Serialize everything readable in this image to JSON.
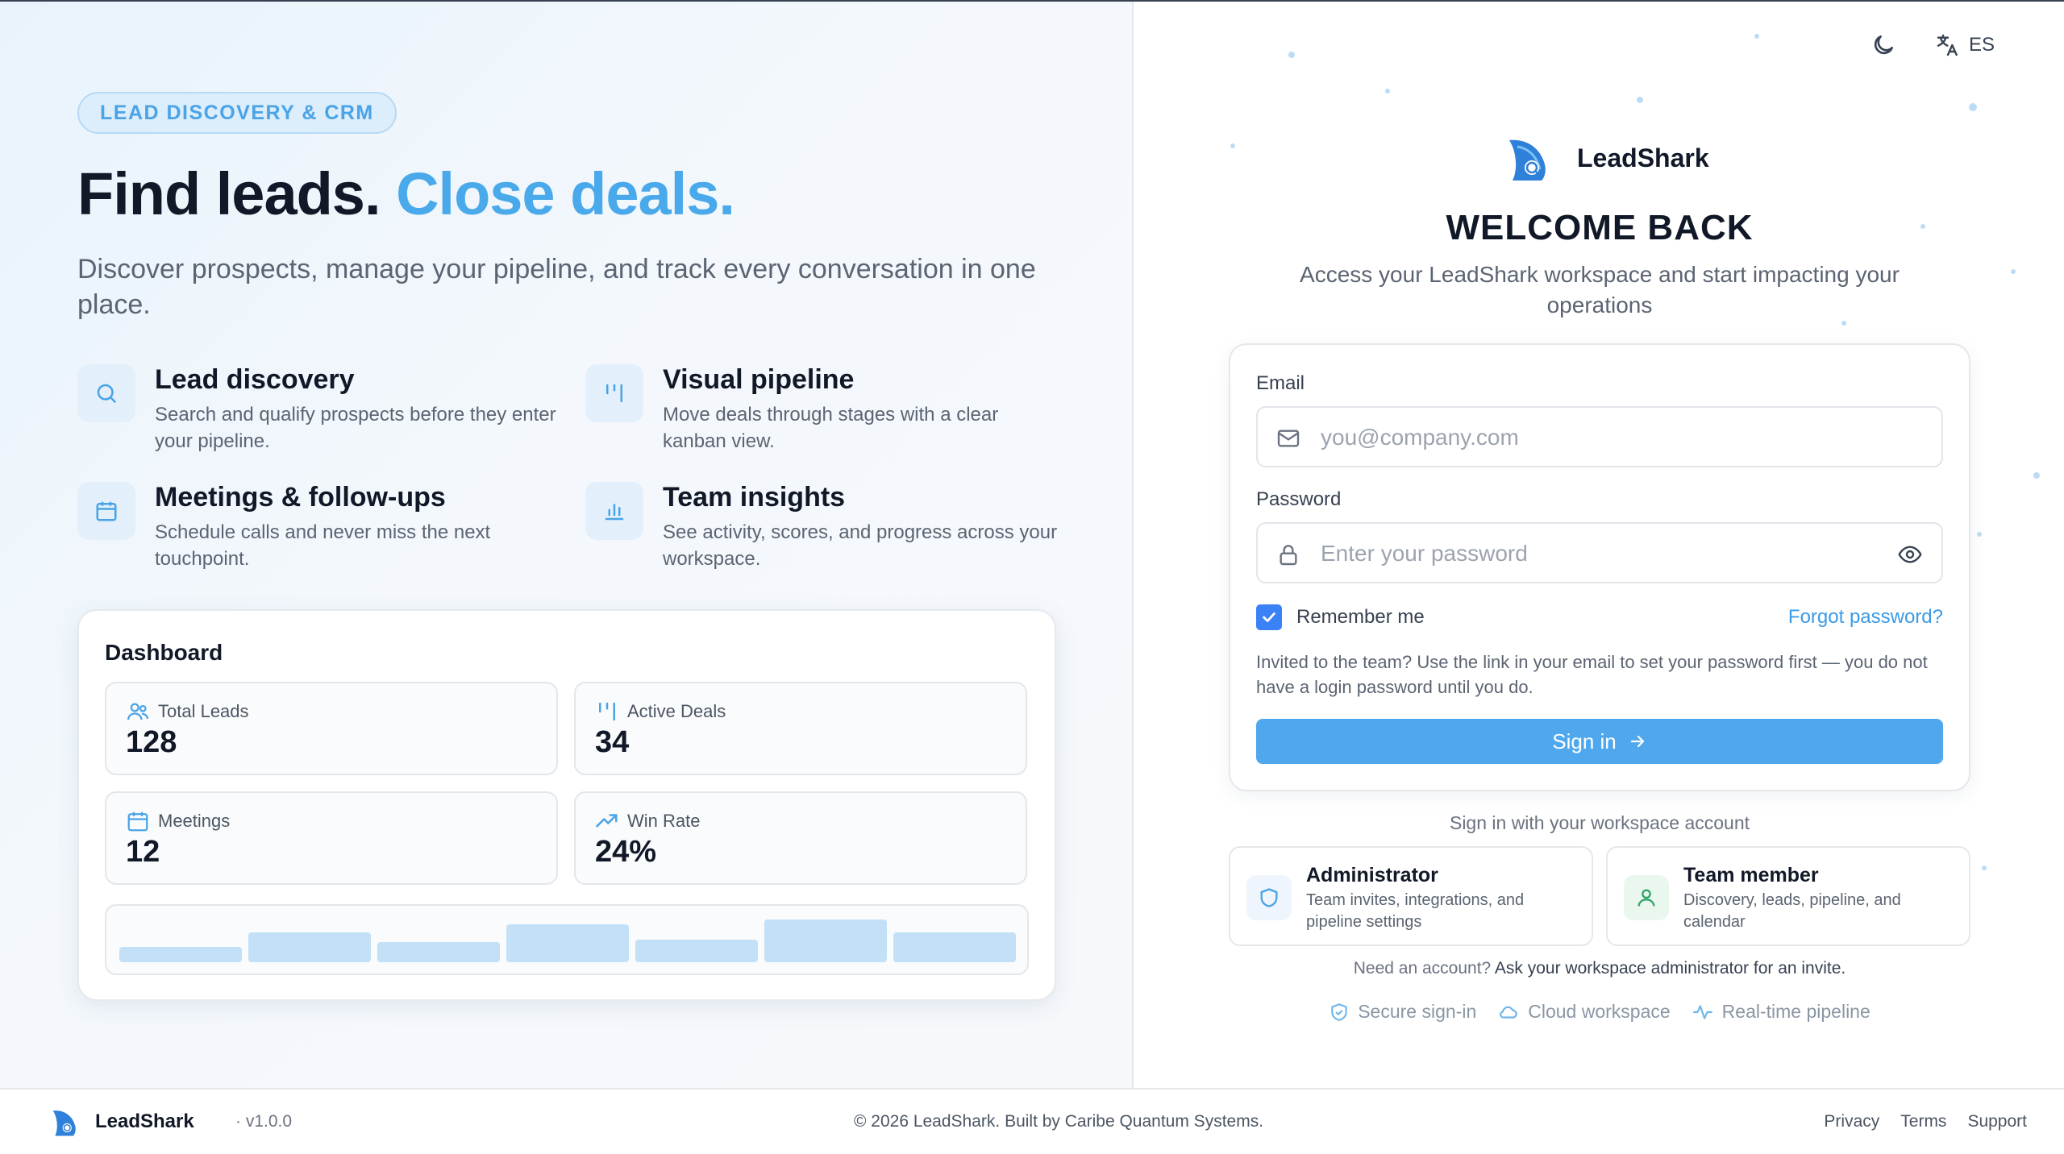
{
  "hero": {
    "badge": "LEAD DISCOVERY & CRM",
    "headline_dark": "Find leads.",
    "headline_accent": "Close deals.",
    "intro": "Discover prospects, manage your pipeline, and track every conversation in one place."
  },
  "features": [
    {
      "icon": "search-icon",
      "title": "Lead discovery",
      "desc": "Search and qualify prospects before they enter your pipeline."
    },
    {
      "icon": "pipeline-icon",
      "title": "Visual pipeline",
      "desc": "Move deals through stages with a clear kanban view."
    },
    {
      "icon": "calendar-icon",
      "title": "Meetings & follow-ups",
      "desc": "Schedule calls and never miss the next touchpoint."
    },
    {
      "icon": "bar-chart-icon",
      "title": "Team insights",
      "desc": "See activity, scores, and progress across your workspace."
    }
  ],
  "dashboard": {
    "title": "Dashboard",
    "stats": [
      {
        "icon": "users-icon",
        "label": "Total Leads",
        "value": "128"
      },
      {
        "icon": "pipeline-icon",
        "label": "Active Deals",
        "value": "34"
      },
      {
        "icon": "calendar-icon",
        "label": "Meetings",
        "value": "12"
      },
      {
        "icon": "trend-up-icon",
        "label": "Win Rate",
        "value": "24%"
      }
    ],
    "bar_levels": [
      0.3,
      0.6,
      0.4,
      0.75,
      0.45,
      0.85,
      0.6
    ]
  },
  "topbar": {
    "theme_icon": "moon-icon",
    "language_icon": "translate-icon",
    "language": "ES"
  },
  "brand": {
    "name": "LeadShark",
    "logo": "shark-fin-logo"
  },
  "login": {
    "title": "WELCOME BACK",
    "subtitle": "Access your LeadShark workspace and start impacting your operations",
    "email_label": "Email",
    "email_placeholder": "you@company.com",
    "password_label": "Password",
    "password_placeholder": "Enter your password",
    "remember_label": "Remember me",
    "remember_checked": true,
    "forgot_label": "Forgot password?",
    "invite_note": "Invited to the team? Use the link in your email to set your password first — you do not have a login password until you do.",
    "signin_label": "Sign in"
  },
  "workspace": {
    "label": "Sign in with your workspace account",
    "roles": [
      {
        "icon": "shield-icon",
        "title": "Administrator",
        "desc": "Team invites, integrations, and pipeline settings"
      },
      {
        "icon": "user-icon",
        "title": "Team member",
        "desc": "Discovery, leads, pipeline, and calendar"
      }
    ],
    "need_account_prefix": "Need an account?",
    "need_account_text": "Ask your workspace administrator for an invite.",
    "trust": [
      {
        "icon": "shield-check-icon",
        "label": "Secure sign-in"
      },
      {
        "icon": "cloud-icon",
        "label": "Cloud workspace"
      },
      {
        "icon": "activity-icon",
        "label": "Real-time pipeline"
      }
    ]
  },
  "footer": {
    "brand": "LeadShark",
    "version": "· v1.0.0",
    "copyright": "© 2026 LeadShark. Built by Caribe Quantum Systems.",
    "links": [
      "Privacy",
      "Terms",
      "Support"
    ]
  },
  "colors": {
    "accent": "#4aa9ea",
    "primary_button": "#4fa8ee",
    "checkbox": "#3b82f6",
    "link": "#3b9ae6"
  }
}
